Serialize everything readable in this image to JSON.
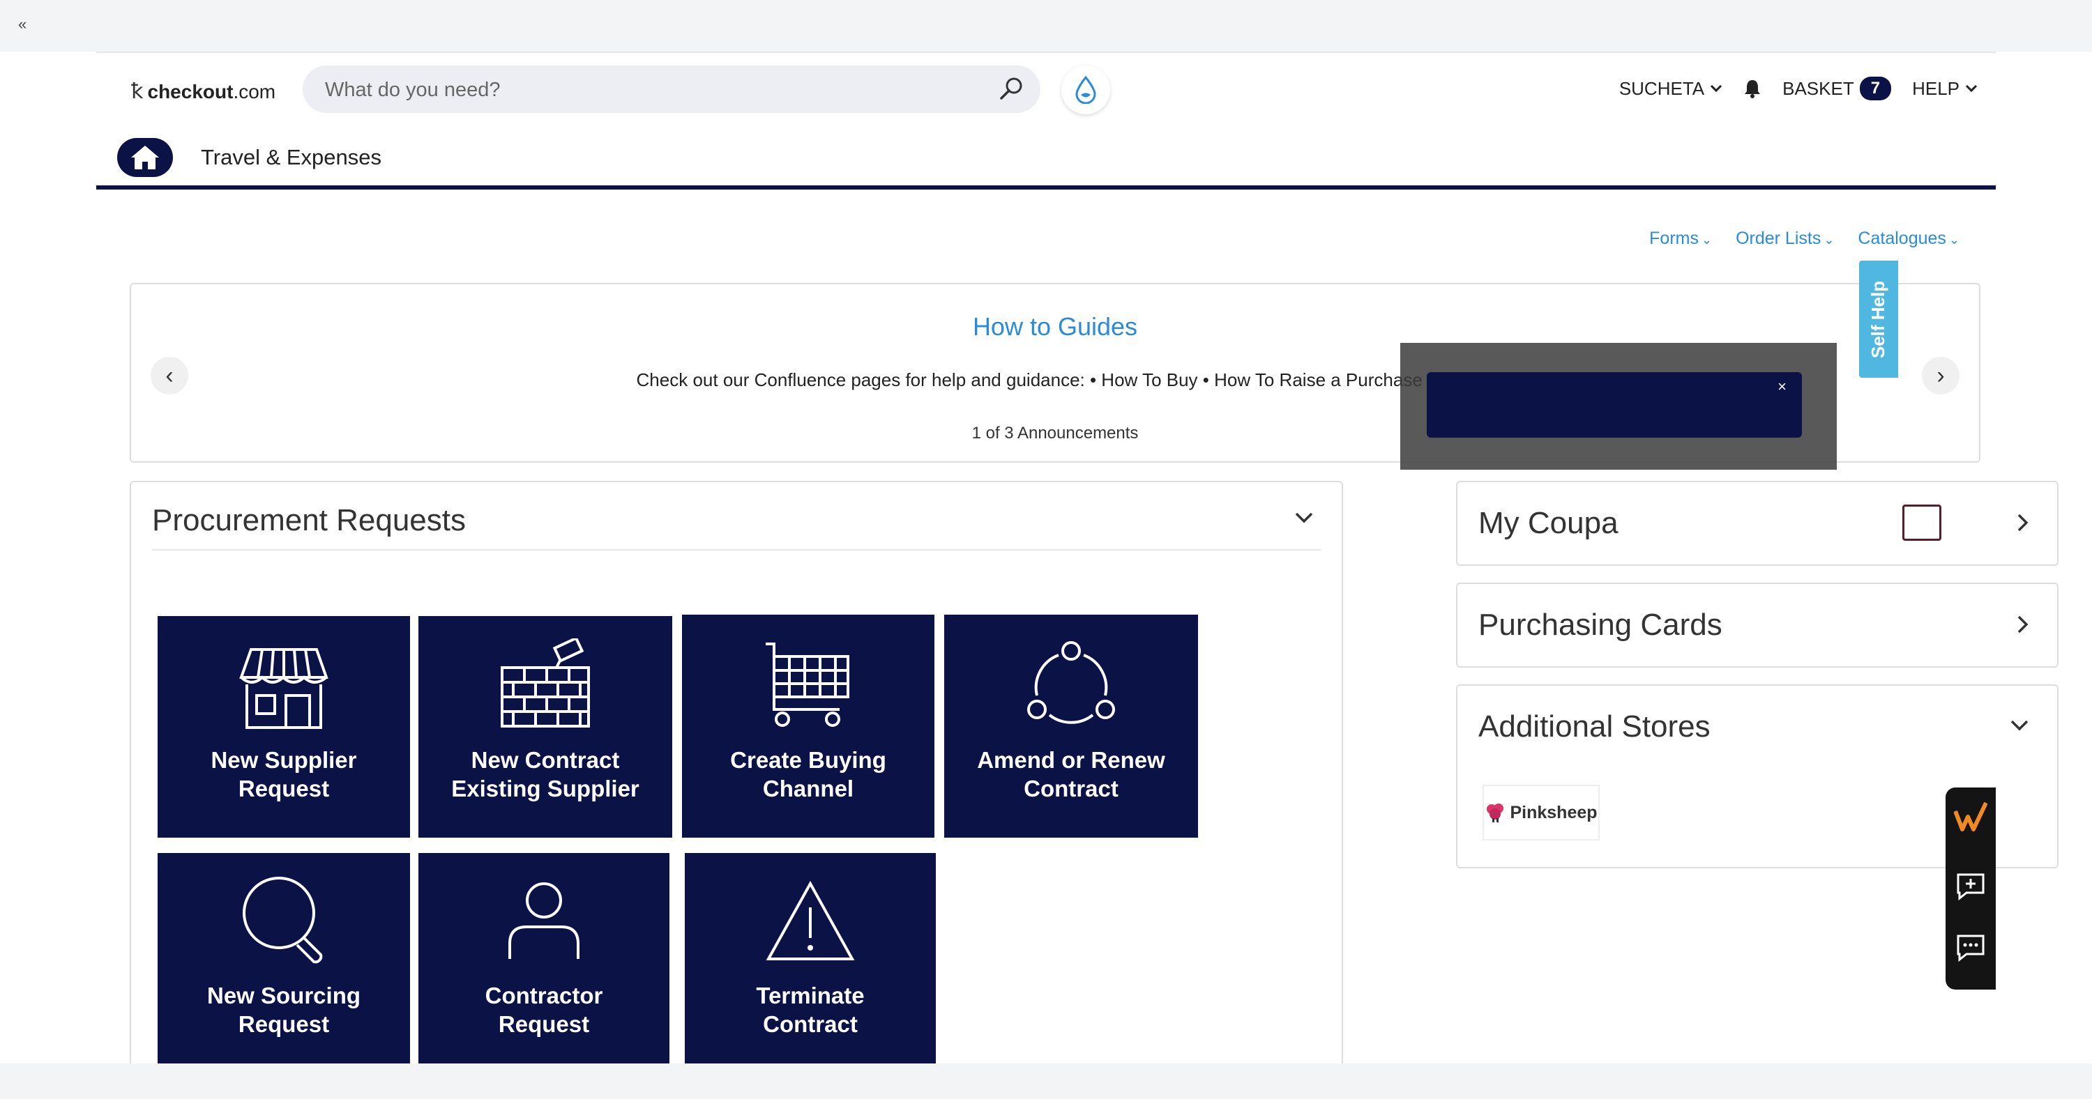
{
  "header": {
    "logo_prefix": "checkout",
    "logo_suffix": ".com",
    "search_placeholder": "What do you need?",
    "user": "SUCHETA",
    "basket_label": "BASKET",
    "basket_count": "7",
    "help_label": "HELP"
  },
  "subnav": {
    "tab_label": "Travel & Expenses"
  },
  "links": {
    "forms": "Forms",
    "order_lists": "Order Lists",
    "catalogues": "Catalogues"
  },
  "announcement": {
    "title": "How to Guides",
    "text": "Check out our Confluence pages for help and guidance: • How To Buy • How To Raise a Purchase Order",
    "count": "1 of 3 Announcements"
  },
  "self_help": "Self Help",
  "procurement": {
    "title": "Procurement Requests",
    "tiles": [
      {
        "line1": "New Supplier",
        "line2": "Request"
      },
      {
        "line1": "New Contract",
        "line2": "Existing Supplier"
      },
      {
        "line1": "Create Buying",
        "line2": "Channel"
      },
      {
        "line1": "Amend or Renew",
        "line2": "Contract"
      },
      {
        "line1": "New Sourcing",
        "line2": "Request"
      },
      {
        "line1": "Contractor",
        "line2": "Request"
      },
      {
        "line1": "Terminate",
        "line2": "Contract"
      }
    ]
  },
  "right_panel": {
    "my_coupa": "My Coupa",
    "purchasing_cards": "Purchasing Cards",
    "additional_stores": "Additional Stores",
    "store_name": "Pinksheep"
  },
  "popup": {
    "close": "×"
  },
  "colors": {
    "navy": "#0b1245",
    "link_blue": "#2a8bd8",
    "self_help_blue": "#4fb7e0"
  }
}
